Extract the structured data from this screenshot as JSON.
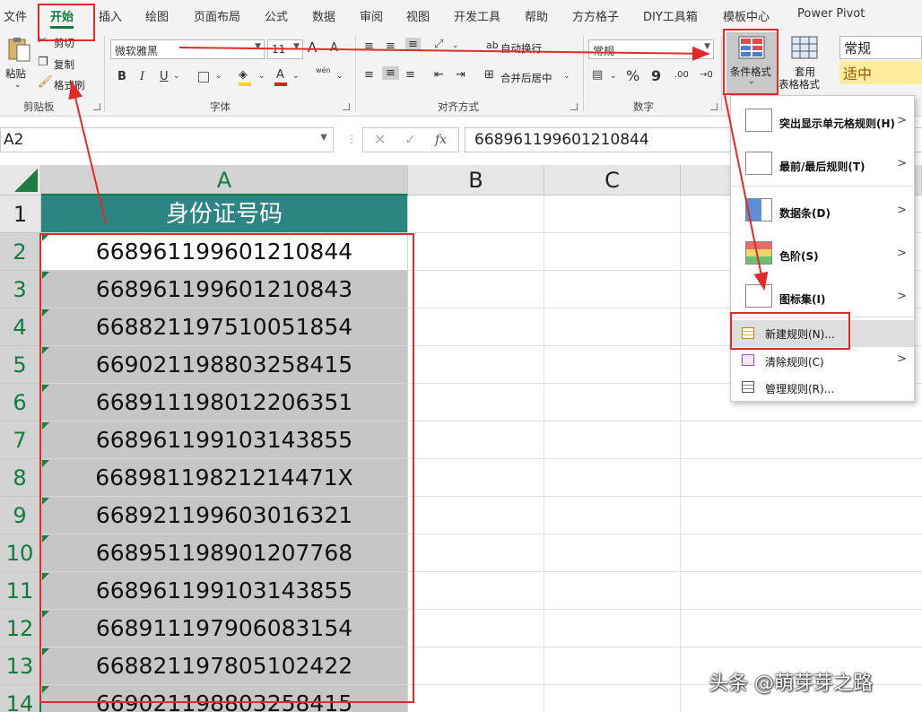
{
  "tabs": [
    "文件",
    "开始",
    "插入",
    "绘图",
    "页面布局",
    "公式",
    "数据",
    "审阅",
    "视图",
    "开发工具",
    "帮助",
    "方方格子",
    "DIY工具箱",
    "模板中心",
    "Power Pivot"
  ],
  "active_tab": "开始",
  "ribbon": {
    "clipboard": {
      "label": "剪贴板",
      "paste": "粘贴",
      "cut": "剪切",
      "copy": "复制",
      "format_painter": "格式刷"
    },
    "font": {
      "label": "字体",
      "font_name": "微软雅黑",
      "font_size": "11",
      "bold": "B",
      "italic": "I",
      "underline": "U",
      "grow": "A",
      "shrink": "A",
      "color_a": "A",
      "wen": "wén"
    },
    "alignment": {
      "label": "对齐方式",
      "wrap_text": "自动换行",
      "merge_center": "合并后居中"
    },
    "number": {
      "label": "数字",
      "format": "常规",
      "percent": "%",
      "comma": "9",
      "inc_dec": ".00",
      "dec_dec": "→0"
    },
    "styles": {
      "conditional_formatting": "条件格式",
      "format_as_table_1": "套用",
      "format_as_table_2": "表格格式",
      "style_normal": "常规",
      "style_neutral": "适中"
    }
  },
  "formula_bar": {
    "name_box": "A2",
    "cancel": "✕",
    "enter": "✓",
    "fx": "fx",
    "content": "668961199601210844"
  },
  "columns": [
    "A",
    "B",
    "C"
  ],
  "rows": [
    {
      "num": "1",
      "value": "身份证号码"
    },
    {
      "num": "2",
      "value": "668961199601210844"
    },
    {
      "num": "3",
      "value": "668961199601210843"
    },
    {
      "num": "4",
      "value": "668821197510051854"
    },
    {
      "num": "5",
      "value": "669021198803258415"
    },
    {
      "num": "6",
      "value": "668911198012206351"
    },
    {
      "num": "7",
      "value": "668961199103143855"
    },
    {
      "num": "8",
      "value": "66898119821214471X"
    },
    {
      "num": "9",
      "value": "668921199603016321"
    },
    {
      "num": "10",
      "value": "668951198901207768"
    },
    {
      "num": "11",
      "value": "668961199103143855"
    },
    {
      "num": "12",
      "value": "668911197906083154"
    },
    {
      "num": "13",
      "value": "668821197805102422"
    },
    {
      "num": "14",
      "value": "669021198803258415"
    }
  ],
  "cf_menu": {
    "highlight_rules": "突出显示单元格规则(H)",
    "top_bottom": "最前/最后规则(T)",
    "data_bars": "数据条(D)",
    "color_scales": "色阶(S)",
    "icon_sets": "图标集(I)",
    "new_rule": "新建规则(N)...",
    "clear_rules": "清除规则(C)",
    "manage_rules": "管理规则(R)...",
    "chevron": ">"
  },
  "watermark": "头条 @萌芽芽之路",
  "colors": {
    "excel_green": "#107c41",
    "header_fill": "#2d8582",
    "selection_gray": "#c6c6c6",
    "annotation_red": "#e32a2a"
  }
}
